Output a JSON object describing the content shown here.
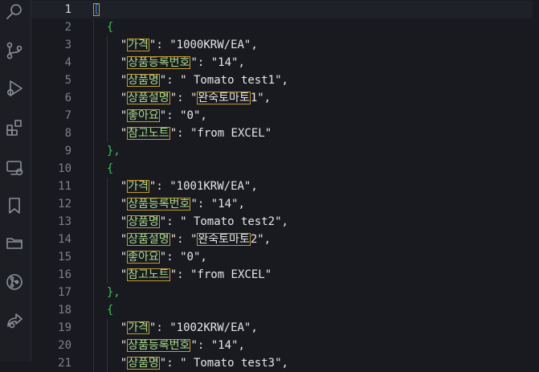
{
  "activity_bar": {
    "icons": [
      "search-icon",
      "source-control-icon",
      "run-debug-icon",
      "extensions-icon",
      "remote-explorer-icon",
      "bookmark-icon",
      "folder-icon",
      "git-graph-icon",
      "share-icon"
    ]
  },
  "editor": {
    "current_line": 1,
    "lines": [
      {
        "n": "1",
        "text": "["
      },
      {
        "n": "2",
        "text": "{"
      },
      {
        "n": "3",
        "key": "가격",
        "value": "\"1000KRW/EA\","
      },
      {
        "n": "4",
        "key": "상품등록번호",
        "value": "\"14\","
      },
      {
        "n": "5",
        "key": "상품명",
        "value": "\" Tomato test1\","
      },
      {
        "n": "6",
        "key": "상품설명",
        "value_hl": "완숙토마토",
        "value_tail": "1\","
      },
      {
        "n": "7",
        "key": "좋아요",
        "value": "\"0\","
      },
      {
        "n": "8",
        "key": "참고노트",
        "value": "\"from EXCEL\""
      },
      {
        "n": "9",
        "text": "},"
      },
      {
        "n": "10",
        "text": "{"
      },
      {
        "n": "11",
        "key": "가격",
        "value": "\"1001KRW/EA\","
      },
      {
        "n": "12",
        "key": "상품등록번호",
        "value": "\"14\","
      },
      {
        "n": "13",
        "key": "상품명",
        "value": "\" Tomato test2\","
      },
      {
        "n": "14",
        "key": "상품설명",
        "value_hl": "완숙토마토",
        "value_tail": "2\","
      },
      {
        "n": "15",
        "key": "좋아요",
        "value": "\"0\","
      },
      {
        "n": "16",
        "key": "참고노트",
        "value": "\"from EXCEL\""
      },
      {
        "n": "17",
        "text": "},"
      },
      {
        "n": "18",
        "text": "{"
      },
      {
        "n": "19",
        "key": "가격",
        "value": "\"1002KRW/EA\","
      },
      {
        "n": "20",
        "key": "상품등록번호",
        "value": "\"14\","
      },
      {
        "n": "21",
        "key": "상품명",
        "value": "\" Tomato test3\","
      }
    ]
  },
  "colors": {
    "background": "#181a20",
    "key": "#a9d98a",
    "highlight_border": "#c49a2d",
    "brace": "#3fbf5a",
    "bracket": "#3f7be0"
  }
}
